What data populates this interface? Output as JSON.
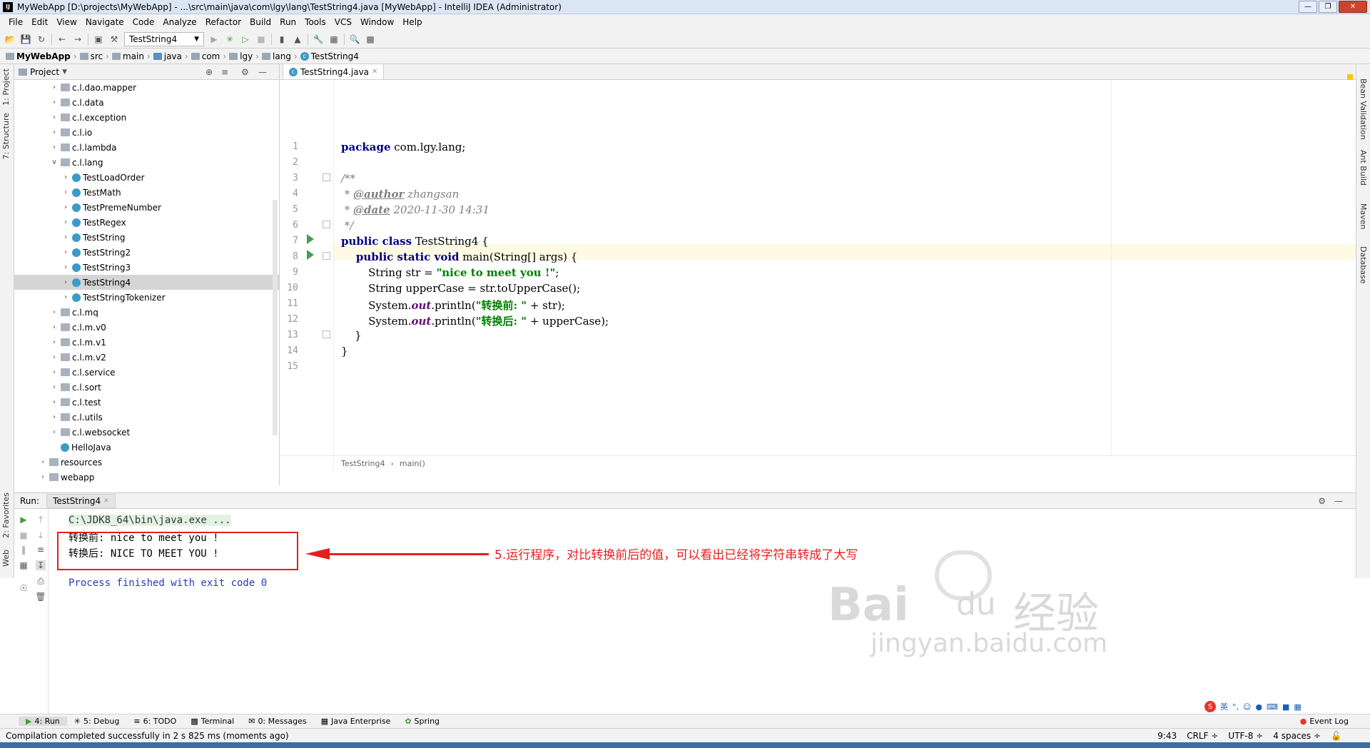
{
  "window": {
    "title": "MyWebApp [D:\\projects\\MyWebApp] - ...\\src\\main\\java\\com\\lgy\\lang\\TestString4.java [MyWebApp] - IntelliJ IDEA (Administrator)",
    "app_icon": "IJ"
  },
  "menu": [
    "File",
    "Edit",
    "View",
    "Navigate",
    "Code",
    "Analyze",
    "Refactor",
    "Build",
    "Run",
    "Tools",
    "VCS",
    "Window",
    "Help"
  ],
  "toolbar": {
    "run_config": "TestString4"
  },
  "breadcrumb": [
    "MyWebApp",
    "src",
    "main",
    "java",
    "com",
    "lgy",
    "lang",
    "TestString4"
  ],
  "left_tabs": {
    "project": "1: Project",
    "structure": "7: Structure",
    "favorites": "2: Favorites",
    "web": "Web"
  },
  "right_tabs": {
    "bean": "Bean Validation",
    "ant": "Ant Build",
    "maven": "Maven",
    "database": "Database"
  },
  "project_panel": {
    "title": "Project",
    "tree": [
      {
        "label": "c.l.dao.mapper",
        "type": "package",
        "indent": 1
      },
      {
        "label": "c.l.data",
        "type": "package",
        "indent": 1
      },
      {
        "label": "c.l.exception",
        "type": "package",
        "indent": 1
      },
      {
        "label": "c.l.io",
        "type": "package",
        "indent": 1
      },
      {
        "label": "c.l.lambda",
        "type": "package",
        "indent": 1
      },
      {
        "label": "c.l.lang",
        "type": "package",
        "indent": 1,
        "expanded": true
      },
      {
        "label": "TestLoadOrder",
        "type": "class",
        "indent": 2
      },
      {
        "label": "TestMath",
        "type": "class",
        "indent": 2
      },
      {
        "label": "TestPremeNumber",
        "type": "class",
        "indent": 2
      },
      {
        "label": "TestRegex",
        "type": "class",
        "indent": 2
      },
      {
        "label": "TestString",
        "type": "class",
        "indent": 2
      },
      {
        "label": "TestString2",
        "type": "class",
        "indent": 2
      },
      {
        "label": "TestString3",
        "type": "class",
        "indent": 2
      },
      {
        "label": "TestString4",
        "type": "class",
        "indent": 2,
        "selected": true
      },
      {
        "label": "TestStringTokenizer",
        "type": "class",
        "indent": 2
      },
      {
        "label": "c.l.mq",
        "type": "package",
        "indent": 1
      },
      {
        "label": "c.l.m.v0",
        "type": "package",
        "indent": 1
      },
      {
        "label": "c.l.m.v1",
        "type": "package",
        "indent": 1
      },
      {
        "label": "c.l.m.v2",
        "type": "package",
        "indent": 1
      },
      {
        "label": "c.l.service",
        "type": "package",
        "indent": 1
      },
      {
        "label": "c.l.sort",
        "type": "package",
        "indent": 1
      },
      {
        "label": "c.l.test",
        "type": "package",
        "indent": 1
      },
      {
        "label": "c.l.utils",
        "type": "package",
        "indent": 1
      },
      {
        "label": "c.l.websocket",
        "type": "package",
        "indent": 1
      },
      {
        "label": "HelloJava",
        "type": "class",
        "indent": 1
      },
      {
        "label": "resources",
        "type": "package",
        "indent": 0
      },
      {
        "label": "webapp",
        "type": "package",
        "indent": 0
      }
    ]
  },
  "editor": {
    "tab": "TestString4.java",
    "line_numbers": [
      "1",
      "2",
      "3",
      "4",
      "5",
      "6",
      "7",
      "8",
      "9",
      "10",
      "11",
      "12",
      "13",
      "14",
      "15"
    ],
    "code": {
      "l1_kw": "package",
      "l1_rest": " com.lgy.lang;",
      "l3": "/**",
      "l4_pre": " * ",
      "l4_tag": "@author",
      "l4_rest": " zhangsan",
      "l5_pre": " * ",
      "l5_tag": "@date",
      "l5_rest": " 2020-11-30 14:31",
      "l6": " */",
      "l7_kw": "public class",
      "l7_rest": " TestString4 {",
      "l8_kw": "    public static void",
      "l8_rest": " main(String[] args) {",
      "l9_pre": "        String str = ",
      "l9_str": "\"nice to meet you !\"",
      "l9_post": ";",
      "l10": "        String upperCase = str.toUpperCase();",
      "l11_pre": "        System.",
      "l11_fld": "out",
      "l11_mid": ".println(",
      "l11_str": "\"转换前: \"",
      "l11_post": " + str);",
      "l12_pre": "        System.",
      "l12_fld": "out",
      "l12_mid": ".println(",
      "l12_str": "\"转换后: \"",
      "l12_post": " + upperCase);",
      "l13": "    }",
      "l14": "}"
    },
    "breadcrumb": [
      "TestString4",
      "main()"
    ]
  },
  "run_panel": {
    "label": "Run:",
    "tab": "TestString4",
    "console": {
      "cmd": "C:\\JDK8_64\\bin\\java.exe ...",
      "out1": "转换前: nice to meet you !",
      "out2": "转换后: NICE TO MEET YOU !",
      "exit": "Process finished with exit code 0"
    },
    "annotation": "5.运行程序，对比转换前后的值，可以看出已经将字符串转成了大写"
  },
  "watermark": {
    "brand": "Bai",
    "brand2": "du",
    "cn": "经验",
    "url": "jingyan.baidu.com"
  },
  "bottom_tools": [
    "4: Run",
    "5: Debug",
    "6: TODO",
    "Terminal",
    "0: Messages",
    "Java Enterprise",
    "Spring"
  ],
  "event_log": "Event Log",
  "status": {
    "message": "Compilation completed successfully in 2 s 825 ms (moments ago)",
    "position": "9:43",
    "line_sep": "CRLF ÷",
    "encoding": "UTF-8 ÷",
    "indent": "4 spaces ÷"
  },
  "ime": {
    "lang": "英"
  }
}
